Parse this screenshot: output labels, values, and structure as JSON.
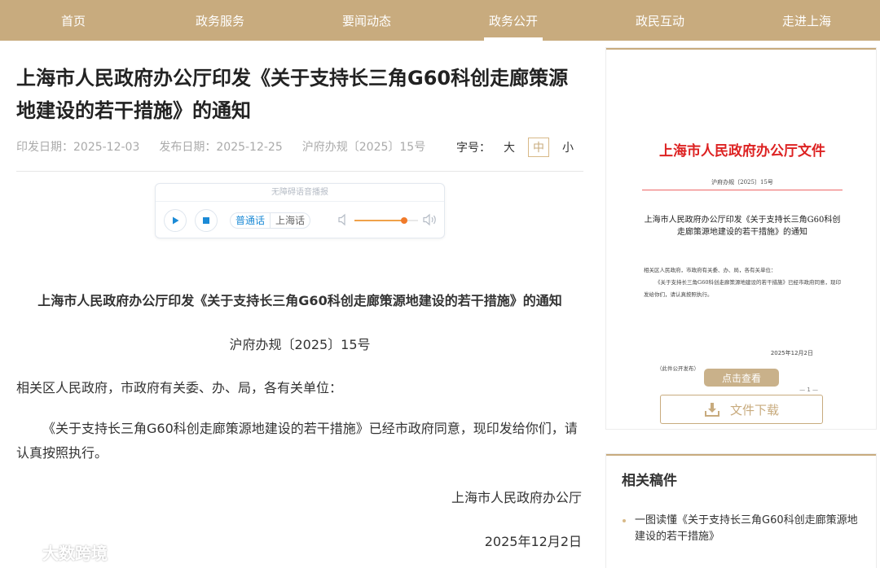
{
  "nav": {
    "items": [
      {
        "label": "首页"
      },
      {
        "label": "政务服务"
      },
      {
        "label": "要闻动态"
      },
      {
        "label": "政务公开"
      },
      {
        "label": "政民互动"
      },
      {
        "label": "走进上海"
      }
    ],
    "active_index": 3
  },
  "article": {
    "title": "上海市人民政府办公厅印发《关于支持长三角G60科创走廊策源地建设的若干措施》的通知",
    "meta": {
      "issue_date": "印发日期：2025-12-03",
      "publish_date": "发布日期：2025-12-25",
      "doc_number": "沪府办规〔2025〕15号"
    },
    "font_size": {
      "label": "字号：",
      "large": "大",
      "medium": "中",
      "small": "小",
      "selected": "中"
    },
    "player": {
      "caption": "无障碍语音播报",
      "lang_mandarin": "普通话",
      "lang_shanghai": "上海话",
      "volume": 0.78
    },
    "doc_title": "上海市人民政府办公厅印发《关于支持长三角G60科创走廊策源地建设的若干措施》的通知",
    "doc_number": "沪府办规〔2025〕15号",
    "salutation": "相关区人民政府，市政府有关委、办、局，各有关单位：",
    "body": "《关于支持长三角G60科创走廊策源地建设的若干措施》已经市政府同意，现印发给你们，请认真按照执行。",
    "signature": "上海市人民政府办公厅",
    "date": "2025年12月2日"
  },
  "watermark": "大数跨境",
  "doc_card": {
    "preview_head": "上海市人民政府办公厅文件",
    "preview_no": "沪府办规〔2025〕15号",
    "preview_title": "上海市人民政府办公厅印发《关于支持长三角G60科创走廊策源地建设的若干措施》的通知",
    "preview_body_1": "相关区人民政府，市政府有关委、办、局，各有关单位：",
    "preview_body_2": "《关于支持长三角G60科创走廊策源地建设的若干措施》已经市政府同意，现印发给你们，请认真按照执行。",
    "preview_date": "2025年12月2日",
    "preview_public": "（此件公开发布）",
    "preview_page": "— 1 —",
    "view_label": "点击查看",
    "download_label": "文件下载"
  },
  "related": {
    "title": "相关稿件",
    "items": [
      {
        "label": "一图读懂《关于支持长三角G60科创走廊策源地建设的若干措施》"
      }
    ]
  },
  "colors": {
    "brand": "#c8ab7e",
    "red": "#dd2222",
    "player_blue": "#1b8ad6",
    "volume_orange": "#f07a2a"
  }
}
